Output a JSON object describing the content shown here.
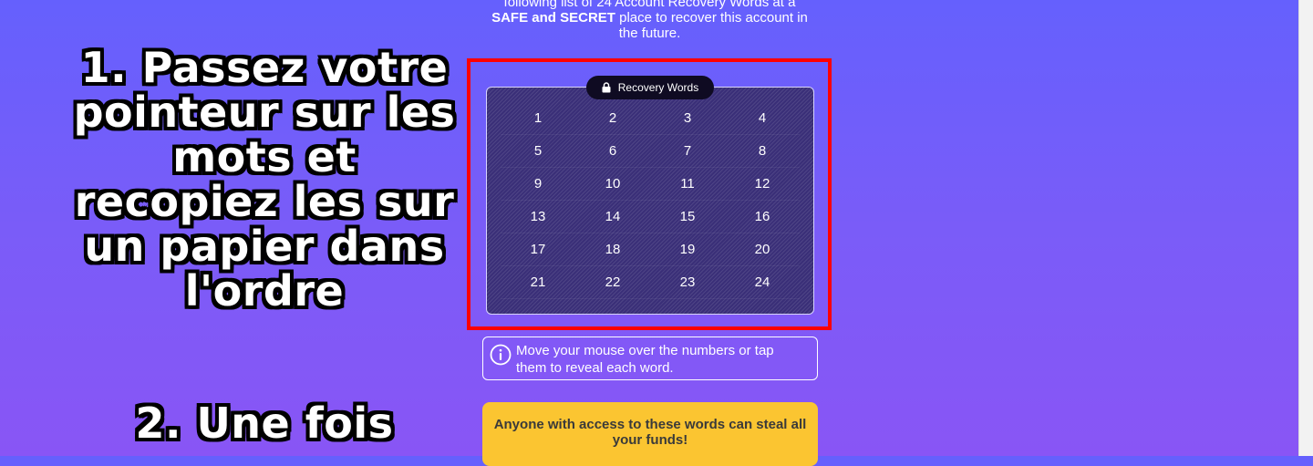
{
  "overlay": {
    "step1": "1. Passez votre pointeur sur les mots et recopiez les sur un papier dans l'ordre",
    "step2": "2. Une fois"
  },
  "intro": {
    "line1": "following list of 24 Account Recovery Words at a",
    "safe_secret": "SAFE and SECRET",
    "line2": " place to recover this account in",
    "line3": "the future."
  },
  "recovery": {
    "label": "Recovery Words",
    "lock_icon": "lock-icon",
    "words": [
      "1",
      "2",
      "3",
      "4",
      "5",
      "6",
      "7",
      "8",
      "9",
      "10",
      "11",
      "12",
      "13",
      "14",
      "15",
      "16",
      "17",
      "18",
      "19",
      "20",
      "21",
      "22",
      "23",
      "24"
    ]
  },
  "info": {
    "icon": "info-icon",
    "text": "Move your mouse over the numbers or tap them to reveal each word."
  },
  "warning": {
    "text": "Anyone with access to these words can steal all your funds!"
  },
  "colors": {
    "highlight": "#ff0000",
    "warning_bg": "#fbc531",
    "panel_bg": "#3a2f78",
    "background_top": "#6560fd",
    "background_bottom": "#8955f5"
  }
}
